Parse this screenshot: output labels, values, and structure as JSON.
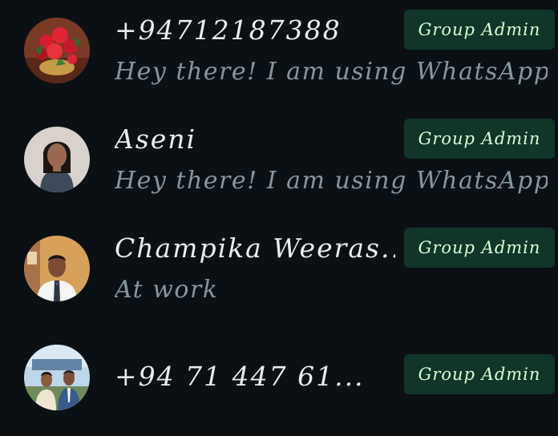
{
  "participants": [
    {
      "name": "+94712187388",
      "status": "Hey there! I am using WhatsApp.",
      "badge": "Group Admin",
      "avatar": "flowers-photo"
    },
    {
      "name": "Aseni",
      "status": "Hey there! I am using WhatsApp.",
      "badge": "Group Admin",
      "avatar": "woman-portrait-photo"
    },
    {
      "name": "Champika Weeras...",
      "status": "At work",
      "badge": "Group Admin",
      "avatar": "man-portrait-photo"
    },
    {
      "name": "+94 71 447 61...",
      "status": "",
      "badge": "Group Admin",
      "avatar": "couple-photo"
    }
  ],
  "colors": {
    "background": "#0b1014",
    "name_text": "#e9edef",
    "status_text": "#8696a0",
    "badge_bg": "#103529",
    "badge_text": "#d9fdd3"
  }
}
